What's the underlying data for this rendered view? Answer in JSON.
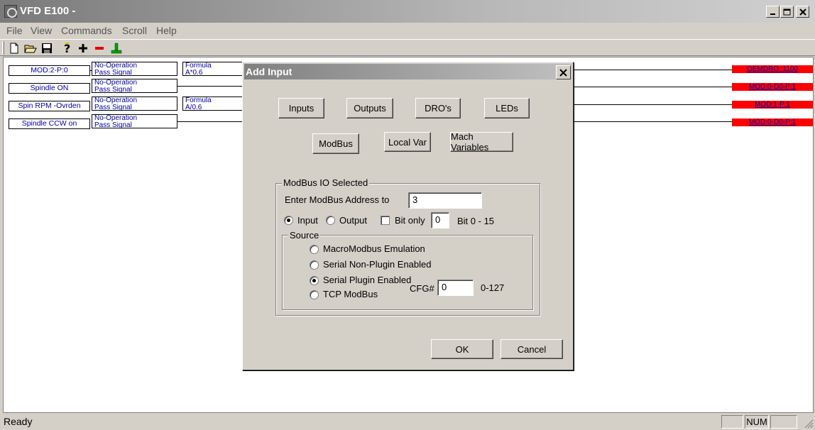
{
  "window": {
    "title": "VFD E100 -"
  },
  "menu": [
    "File",
    "View",
    "Commands",
    "Scroll",
    "Help"
  ],
  "toolbar": {
    "icons": [
      "new-file-icon",
      "open-folder-icon",
      "save-icon",
      "help-icon",
      "add-icon",
      "remove-icon",
      "connect-icon"
    ]
  },
  "canvas": {
    "rows": [
      {
        "input": "MOD:2-P:0",
        "op_line1": "No-Operation",
        "op_line2": "Pass Signal",
        "formula_line1": "Formula",
        "formula_line2": "A*0.6",
        "output": "OEMDRO::1100"
      },
      {
        "input": "Spindle ON",
        "op_line1": "No-Operation",
        "op_line2": "Pass Signal",
        "formula_line1": "",
        "formula_line2": "",
        "output": "MOD:0-D0-P:1"
      },
      {
        "input": "Spin RPM -Ovrden",
        "op_line1": "No-Operation",
        "op_line2": "Pass Signal",
        "formula_line1": "Formula",
        "formula_line2": "A/0.6",
        "output": "MOD:1-P:1"
      },
      {
        "input": "Spindle CCW on",
        "op_line1": "No-Operation",
        "op_line2": "Pass Signal",
        "formula_line1": "",
        "formula_line2": "",
        "output": "MOD:0-D0-P:1"
      }
    ]
  },
  "status": {
    "text": "Ready",
    "num": "NUM"
  },
  "dialog": {
    "title": "Add Input",
    "category_buttons": [
      "Inputs",
      "Outputs",
      "DRO's",
      "LEDs",
      "ModBus",
      "Local Var",
      "Mach Variables"
    ],
    "group_title": "ModBus IO Selected",
    "address_label": "Enter ModBus Address to",
    "address_value": "3",
    "input_label": "Input",
    "output_label": "Output",
    "bit_only_label": "Bit only",
    "bit_value": "0",
    "bit_range_label": "Bit 0 - 15",
    "input_selected": true,
    "bit_only_checked": false,
    "source_title": "Source",
    "sources": [
      {
        "label": "MacroModbus Emulation",
        "selected": false
      },
      {
        "label": "Serial Non-Plugin Enabled",
        "selected": false
      },
      {
        "label": "Serial Plugin Enabled",
        "selected": true
      },
      {
        "label": "TCP ModBus",
        "selected": false
      }
    ],
    "cfg_label": "CFG#",
    "cfg_value": "0",
    "cfg_range": "0-127",
    "ok_label": "OK",
    "cancel_label": "Cancel"
  }
}
